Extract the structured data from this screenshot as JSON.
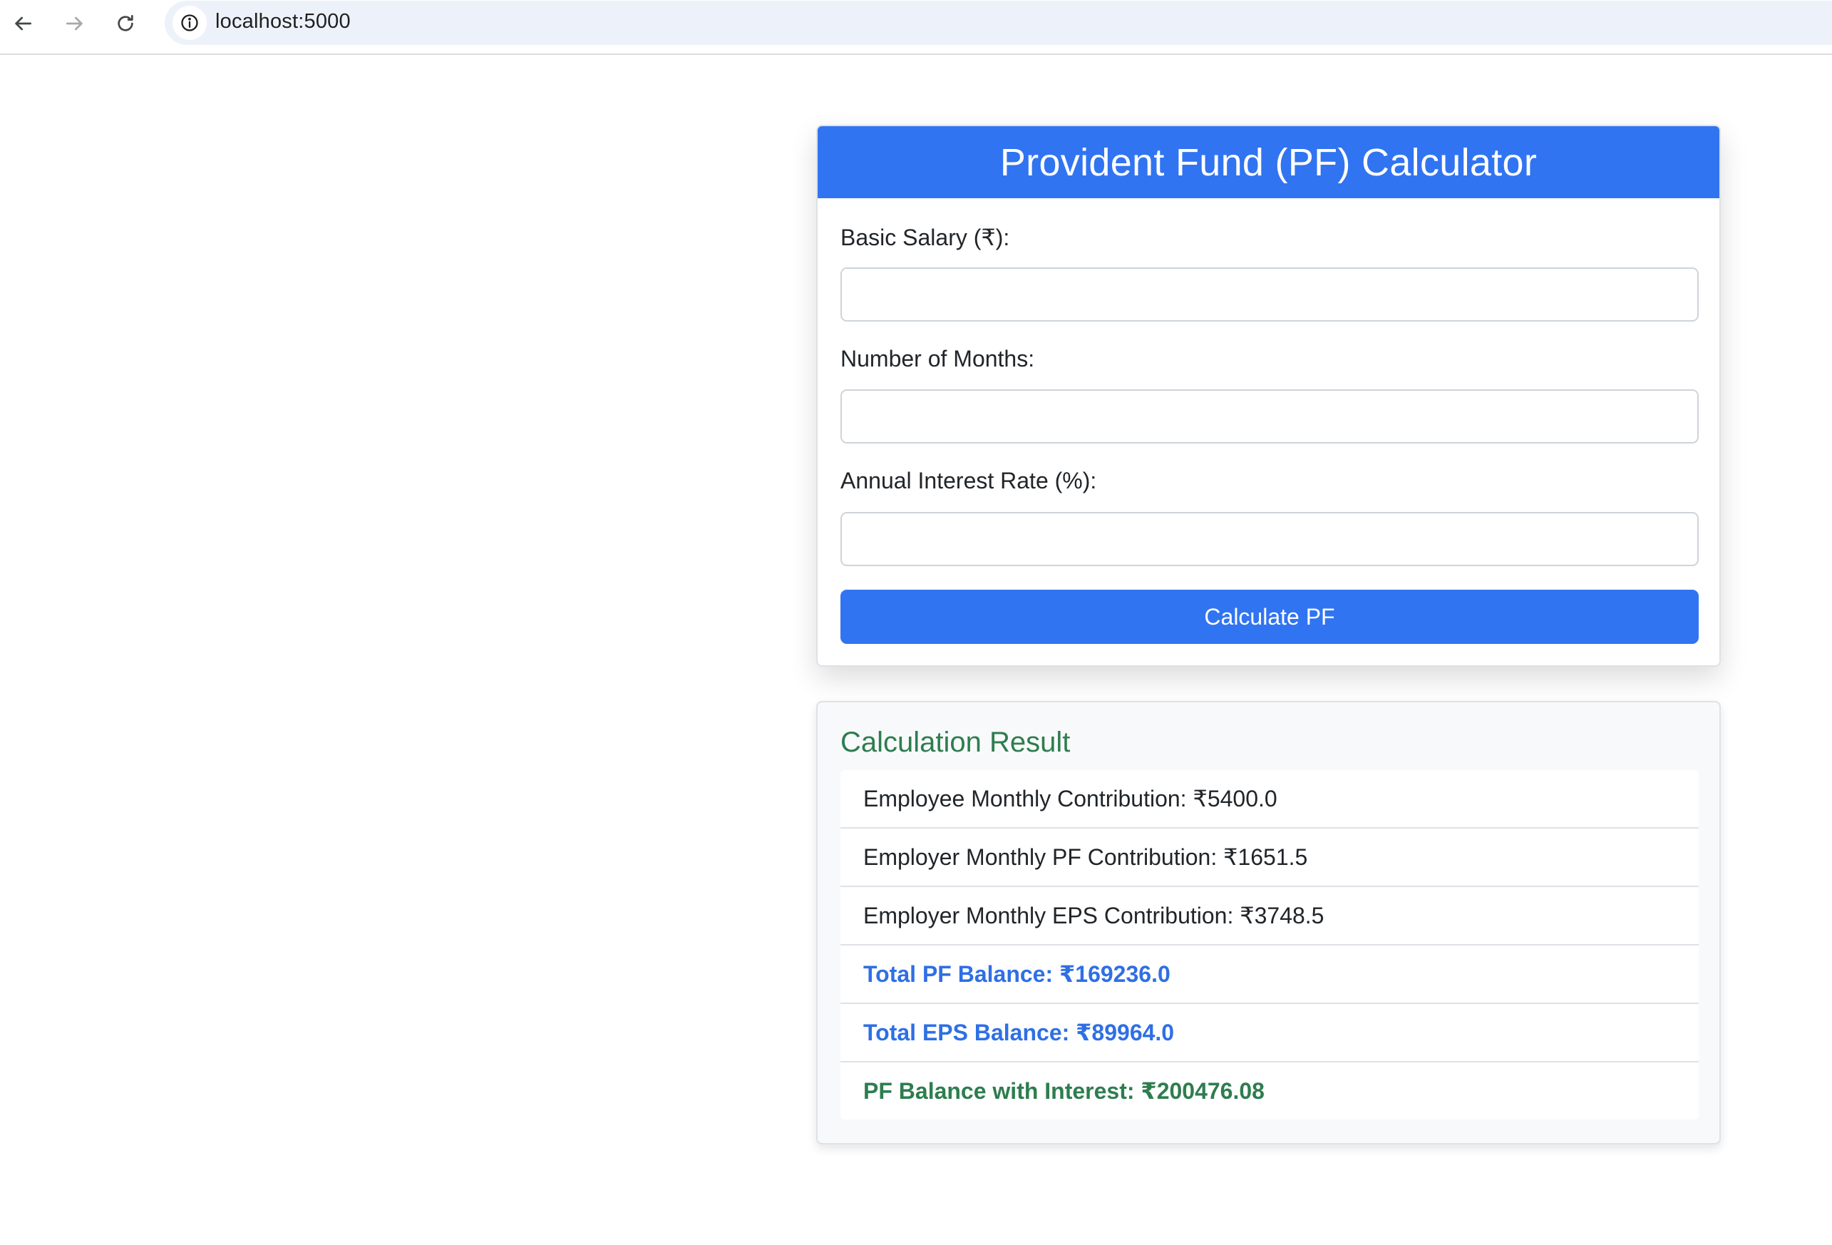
{
  "browser": {
    "url": "localhost:5000"
  },
  "calculator": {
    "title": "Provident Fund (PF) Calculator",
    "fields": [
      {
        "label": "Basic Salary (₹):",
        "value": ""
      },
      {
        "label": "Number of Months:",
        "value": ""
      },
      {
        "label": "Annual Interest Rate (%):",
        "value": ""
      }
    ],
    "button_label": "Calculate PF"
  },
  "result": {
    "title": "Calculation Result",
    "items": [
      {
        "text": "Employee Monthly Contribution: ₹5400.0",
        "style": "normal"
      },
      {
        "text": "Employer Monthly PF Contribution: ₹1651.5",
        "style": "normal"
      },
      {
        "text": "Employer Monthly EPS Contribution: ₹3748.5",
        "style": "normal"
      },
      {
        "text": "Total PF Balance: ₹169236.0",
        "style": "bold-blue"
      },
      {
        "text": "Total EPS Balance: ₹89964.0",
        "style": "bold-blue"
      },
      {
        "text": "PF Balance with Interest: ₹200476.08",
        "style": "bold-green"
      }
    ]
  },
  "colors": {
    "primary": "#3174f1",
    "success": "#2e7d4f",
    "info_blue": "#2f6fe4"
  },
  "icons": {
    "back": "arrow-left-icon",
    "forward": "arrow-right-icon",
    "reload": "reload-icon",
    "site_info": "info-circle-icon"
  }
}
